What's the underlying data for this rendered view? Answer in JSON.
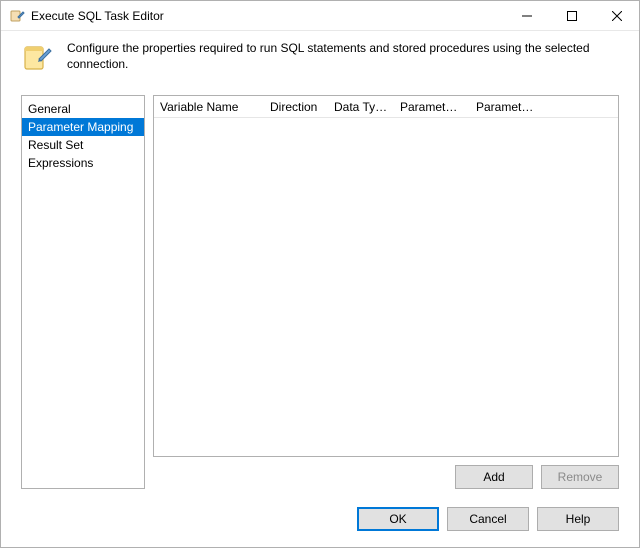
{
  "window": {
    "title": "Execute SQL Task Editor"
  },
  "info": {
    "text": "Configure the properties required to run SQL statements and stored procedures using the selected connection."
  },
  "nav": {
    "items": [
      {
        "label": "General"
      },
      {
        "label": "Parameter Mapping"
      },
      {
        "label": "Result Set"
      },
      {
        "label": "Expressions"
      }
    ],
    "selected_index": 1
  },
  "grid": {
    "columns": [
      {
        "label": "Variable Name",
        "width": 110
      },
      {
        "label": "Direction",
        "width": 64
      },
      {
        "label": "Data Type",
        "width": 66
      },
      {
        "label": "Parameter ...",
        "width": 76
      },
      {
        "label": "Parameter ...",
        "width": 76
      }
    ]
  },
  "buttons": {
    "add": "Add",
    "remove": "Remove",
    "ok": "OK",
    "cancel": "Cancel",
    "help": "Help"
  }
}
